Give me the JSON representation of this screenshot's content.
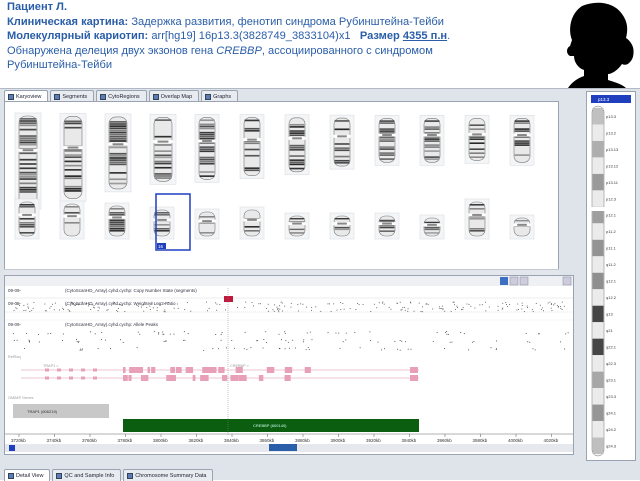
{
  "header": {
    "patient": "Пациент Л.",
    "clinical_label": "Клиническая картина:",
    "clinical_text": "Задержка развития, фенотип синдрома Рубинштейна-Тейби",
    "karyotype_label": "Молекулярный кариотип:",
    "karyotype_value": "arr[hg19] 16p13.3(3828749_3833104)x1",
    "size_label": "Размер",
    "size_value": "4355 п.н",
    "size_suffix": ".",
    "finding_prefix": "Обнаружена делеция двух экзонов гена",
    "gene": "CREBBP",
    "finding_suffix": ", ассоциированного с синдромом",
    "finding_end": "Рубинштейна-Тейби"
  },
  "silhouette": {
    "icon": "child-silhouette-icon",
    "color": "#000000"
  },
  "top_tabs": [
    {
      "label": "Karyoview",
      "active": true
    },
    {
      "label": "Segments",
      "active": false
    },
    {
      "label": "CytoRegions",
      "active": false
    },
    {
      "label": "Overlap Map",
      "active": false
    },
    {
      "label": "Graphs",
      "active": false
    }
  ],
  "karyo_row2_label": "16",
  "tracks": {
    "copy_number_date": "09-09-",
    "copy_number_title": "(CytoScanHD_Array).cyhd.cychp: Copy Number State (segments)",
    "log2_date": "09-09-",
    "log2_title": "(CytoScanHD_Array).cyhd.cychp: Weighted Log2 Ratio",
    "allele_date": "09-09-",
    "allele_title": "(CytoScanHD_Array).cyhd.cychp: Allele Peaks",
    "refseq_label": "RefSeq",
    "omim_label": "OMIM® Genes",
    "gene_trap1": "TRAP1 (606219)",
    "gene_crebbp": "CREBBP (600140)",
    "gene_label_a": "TRAP1 >",
    "gene_label_b": "CREBBP >"
  },
  "ruler": {
    "ticks": [
      "3720kb",
      "3740kb",
      "3760kb",
      "3780kb",
      "3800kb",
      "3820kb",
      "3840kb",
      "3860kb",
      "3880kb",
      "3900kb",
      "3920kb",
      "3940kb",
      "3960kb",
      "3980kb",
      "4000kb",
      "4020kb"
    ]
  },
  "bottom_tabs": [
    {
      "label": "Detail View",
      "active": true
    },
    {
      "label": "QC and Sample Info",
      "active": false
    },
    {
      "label": "Chromosome Summary Data",
      "active": false
    }
  ],
  "ideogram": {
    "top_label": "p13.3",
    "bands": [
      "p13.3",
      "p13.2",
      "p13.13",
      "p13.12",
      "p13.11",
      "p12.3",
      "p12.1",
      "p11.2",
      "p11.1",
      "q11.2",
      "q12.1",
      "q12.2",
      "q13",
      "q21",
      "q22.1",
      "q22.3",
      "q23.1",
      "q23.3",
      "q24.1",
      "q24.2",
      "q24.3"
    ]
  },
  "colors": {
    "accent": "#2a5ea8",
    "copy_loss": "#c0183c",
    "gene_green": "#0b5e10",
    "gene_grey": "#c8c8c8",
    "highlight_blue": "#1f3fbf"
  }
}
